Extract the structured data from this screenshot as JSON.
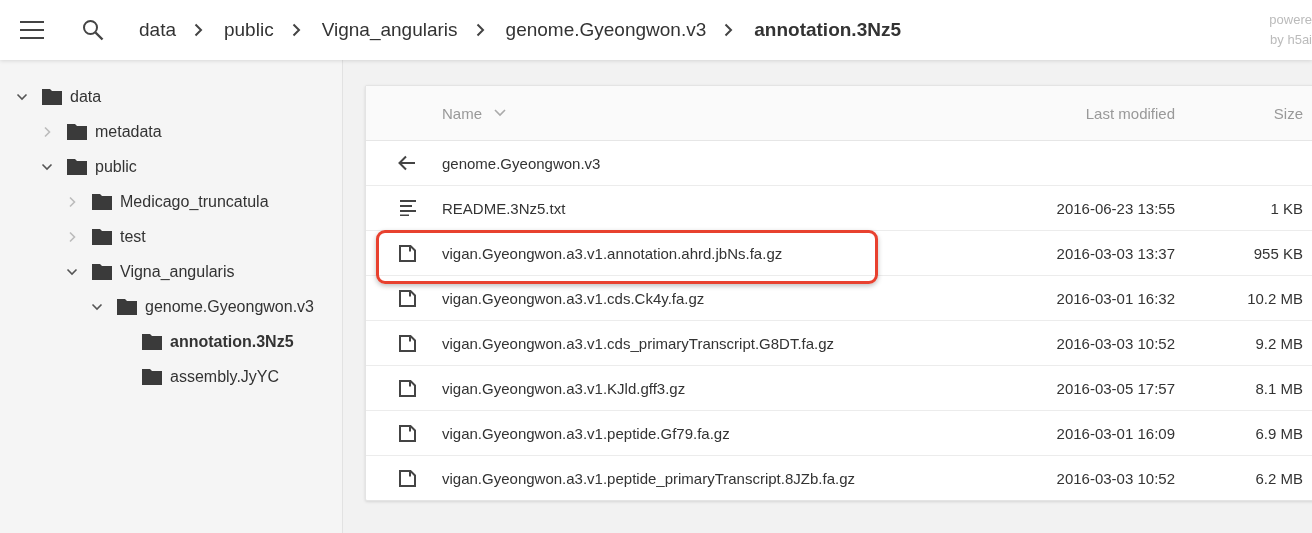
{
  "topbar": {
    "breadcrumb": [
      {
        "label": "data",
        "current": false
      },
      {
        "label": "public",
        "current": false
      },
      {
        "label": "Vigna_angularis",
        "current": false
      },
      {
        "label": "genome.Gyeongwon.v3",
        "current": false
      },
      {
        "label": "annotation.3Nz5",
        "current": true
      }
    ],
    "credit": [
      "powere",
      "by h5ai"
    ]
  },
  "tree": [
    {
      "label": "data",
      "kind": "branch",
      "expanded": true,
      "selected": false,
      "children": [
        {
          "label": "metadata",
          "kind": "branch",
          "expanded": false,
          "selected": false
        },
        {
          "label": "public",
          "kind": "branch",
          "expanded": true,
          "selected": false,
          "children": [
            {
              "label": "Medicago_truncatula",
              "kind": "branch",
              "expanded": false,
              "selected": false
            },
            {
              "label": "test",
              "kind": "branch",
              "expanded": false,
              "selected": false
            },
            {
              "label": "Vigna_angularis",
              "kind": "branch",
              "expanded": true,
              "selected": false,
              "children": [
                {
                  "label": "genome.Gyeongwon.v3",
                  "kind": "branch",
                  "expanded": true,
                  "selected": false,
                  "children": [
                    {
                      "label": "annotation.3Nz5",
                      "kind": "leaf",
                      "selected": true
                    },
                    {
                      "label": "assembly.JyYC",
                      "kind": "leaf",
                      "selected": false
                    }
                  ]
                }
              ]
            }
          ]
        }
      ]
    }
  ],
  "table": {
    "columns": [
      "Name",
      "Last modified",
      "Size"
    ],
    "rows": [
      {
        "kind": "parent",
        "name": "genome.Gyeongwon.v3",
        "highlighted": false
      },
      {
        "kind": "text",
        "name": "README.3Nz5.txt",
        "modified": "2016-06-23 13:55",
        "size": "1 KB",
        "highlighted": false
      },
      {
        "kind": "file",
        "name": "vigan.Gyeongwon.a3.v1.annotation.ahrd.jbNs.fa.gz",
        "modified": "2016-03-03 13:37",
        "size": "955 KB",
        "highlighted": true
      },
      {
        "kind": "file",
        "name": "vigan.Gyeongwon.a3.v1.cds.Ck4y.fa.gz",
        "modified": "2016-03-01 16:32",
        "size": "10.2 MB",
        "highlighted": false
      },
      {
        "kind": "file",
        "name": "vigan.Gyeongwon.a3.v1.cds_primaryTranscript.G8DT.fa.gz",
        "modified": "2016-03-03 10:52",
        "size": "9.2 MB",
        "highlighted": false
      },
      {
        "kind": "file",
        "name": "vigan.Gyeongwon.a3.v1.KJld.gff3.gz",
        "modified": "2016-03-05 17:57",
        "size": "8.1 MB",
        "highlighted": false
      },
      {
        "kind": "file",
        "name": "vigan.Gyeongwon.a3.v1.peptide.Gf79.fa.gz",
        "modified": "2016-03-01 16:09",
        "size": "6.9 MB",
        "highlighted": false
      },
      {
        "kind": "file",
        "name": "vigan.Gyeongwon.a3.v1.peptide_primaryTranscript.8JZb.fa.gz",
        "modified": "2016-03-03 10:52",
        "size": "6.2 MB",
        "highlighted": false
      }
    ]
  }
}
